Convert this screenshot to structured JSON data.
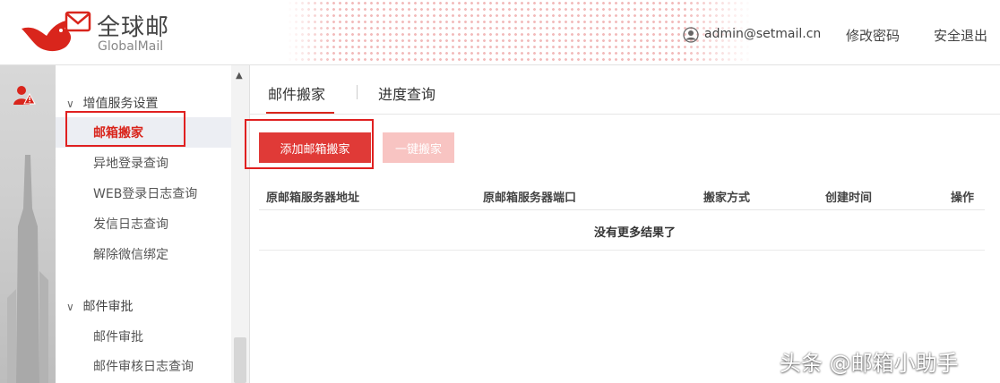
{
  "header": {
    "brand_cn": "全球邮",
    "brand_en": "GlobalMail",
    "user_email": "admin@setmail.cn",
    "change_password": "修改密码",
    "logout": "安全退出"
  },
  "sidebar": {
    "groups": [
      {
        "label": "增值服务设置",
        "items": [
          "邮箱搬家",
          "异地登录查询",
          "WEB登录日志查询",
          "发信日志查询",
          "解除微信绑定"
        ]
      },
      {
        "label": "邮件审批",
        "items": [
          "邮件审批",
          "邮件审核日志查询"
        ]
      }
    ],
    "active_item": "邮箱搬家"
  },
  "tabs": [
    "邮件搬家",
    "进度查询"
  ],
  "active_tab": "邮件搬家",
  "toolbar": {
    "add_button": "添加邮箱搬家",
    "onekey_button": "一键搬家"
  },
  "table": {
    "columns": [
      "原邮箱服务器地址",
      "原邮箱服务器端口",
      "搬家方式",
      "创建时间",
      "操作"
    ],
    "rows": [],
    "empty_text": "没有更多结果了"
  },
  "watermark": "头条 @邮箱小助手",
  "colors": {
    "accent": "#d9251c",
    "button": "#e03a37",
    "button_disabled": "#f8c4c2",
    "highlight_box": "#e02020"
  },
  "icons": [
    "bird-envelope-logo-icon",
    "user-circle-icon",
    "user-alert-icon",
    "chevron-down-icon",
    "scroll-up-arrow-icon"
  ]
}
